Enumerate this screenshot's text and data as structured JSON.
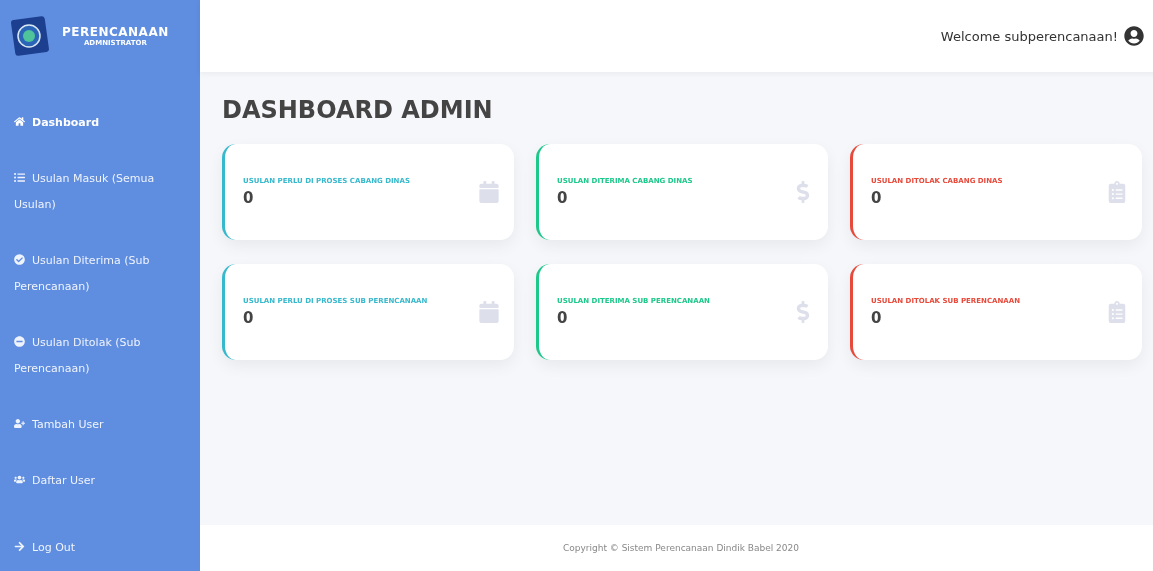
{
  "brand": {
    "title": "PERENCANAAN",
    "subtitle": "ADMNISTRATOR"
  },
  "sidebar": {
    "items": [
      {
        "kind": "home",
        "label": "Dashboard",
        "selected": true
      },
      {
        "kind": "list",
        "label": "Usulan Masuk (Semua Usulan)",
        "selected": false
      },
      {
        "kind": "check",
        "label": "Usulan Diterima (Sub Perencanaan)",
        "selected": false
      },
      {
        "kind": "minus",
        "label": "Usulan Ditolak (Sub Perencanaan)",
        "selected": false
      },
      {
        "kind": "useradd",
        "label": "Tambah User",
        "selected": false
      },
      {
        "kind": "users",
        "label": "Daftar User",
        "selected": false
      }
    ],
    "logout": "Log Out"
  },
  "header": {
    "welcome": "Welcome subperencanaan!"
  },
  "page_title": "DASHBOARD ADMIN",
  "cards": [
    {
      "label": "USULAN PERLU DI PROSES CABANG DINAS",
      "value": "0",
      "color": "#36b9cc",
      "kind": "calendar"
    },
    {
      "label": "USULAN DITERIMA CABANG DINAS",
      "value": "0",
      "color": "#1cc88a",
      "kind": "dollar"
    },
    {
      "label": "USULAN DITOLAK CABANG DINAS",
      "value": "0",
      "color": "#e74a3b",
      "kind": "clipboard"
    },
    {
      "label": "USULAN PERLU DI PROSES SUB PERENCANAAN",
      "value": "0",
      "color": "#36b9cc",
      "kind": "calendar"
    },
    {
      "label": "USULAN DITERIMA SUB PERENCANAAN",
      "value": "0",
      "color": "#1cc88a",
      "kind": "dollar"
    },
    {
      "label": "USULAN DITOLAK SUB PERENCANAAN",
      "value": "0",
      "color": "#e74a3b",
      "kind": "clipboard"
    }
  ],
  "footer": "Copyright © Sistem Perencanaan Dindik Babel 2020"
}
